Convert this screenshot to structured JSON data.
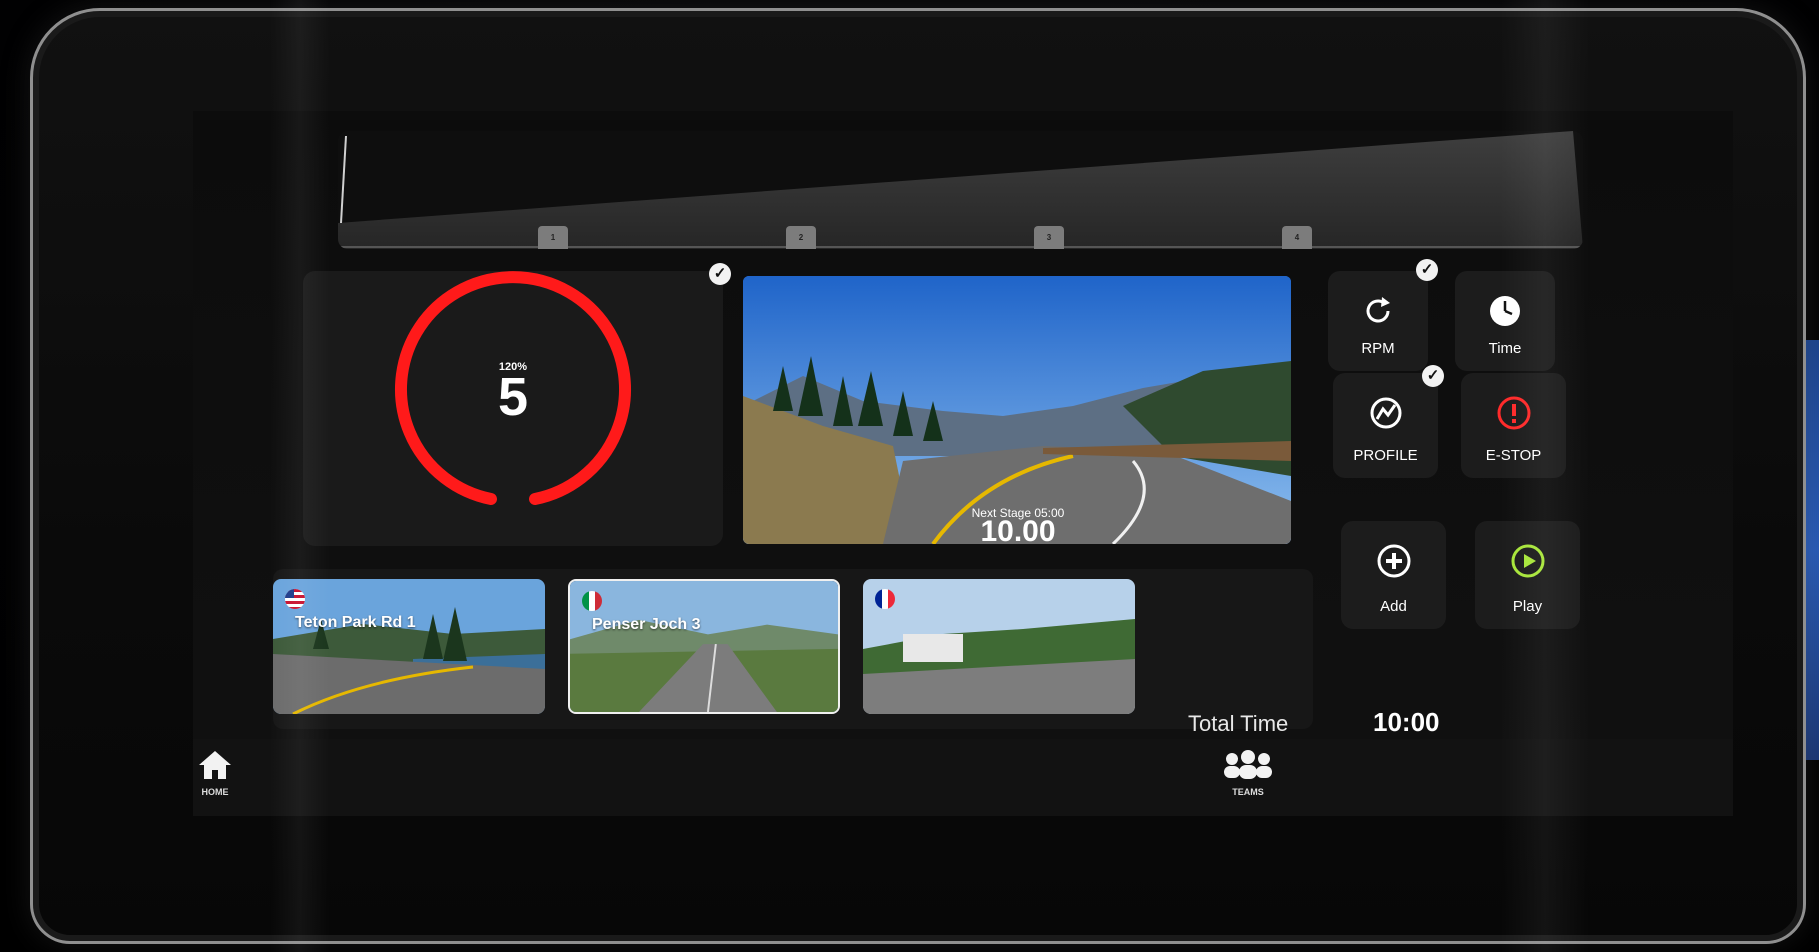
{
  "colors": {
    "gauge_red": "#ff1a1a",
    "estop_red": "#ff2a2a",
    "play_green": "#a8e63a",
    "panel_bg": "#1a1a1a"
  },
  "profile": {
    "stage_markers": [
      "1",
      "2",
      "3",
      "4"
    ]
  },
  "gauge": {
    "percent": "120%",
    "value": "5",
    "check_icon": "check-icon"
  },
  "video": {
    "next_stage_label": "Next Stage 05:00",
    "next_stage_value": "10.00"
  },
  "controls": {
    "rpm": {
      "label": "RPM",
      "icon": "refresh-icon",
      "checked": true
    },
    "time": {
      "label": "Time",
      "icon": "clock-icon"
    },
    "profile": {
      "label": "PROFILE",
      "icon": "profile-chart-icon",
      "checked": true
    },
    "estop": {
      "label": "E-STOP",
      "icon": "alert-icon"
    },
    "add": {
      "label": "Add",
      "icon": "plus-circle-icon"
    },
    "play": {
      "label": "Play",
      "icon": "play-circle-icon"
    }
  },
  "routes": [
    {
      "name": "Teton Park Rd 1",
      "flag": "us-flag-icon"
    },
    {
      "name": "Penser Joch 3",
      "flag": "italy-flag-icon"
    },
    {
      "name": "",
      "flag": "france-flag-icon"
    }
  ],
  "total_time": {
    "label": "Total Time",
    "value": "10:00"
  },
  "nav": {
    "home": "HOME",
    "teams": "TEAMS"
  }
}
